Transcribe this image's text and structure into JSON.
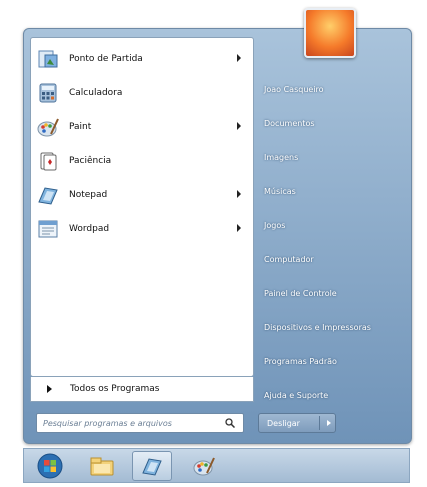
{
  "start_menu": {
    "programs": [
      {
        "label": "Ponto de Partida",
        "icon": "ponto-de-partida-icon",
        "has_submenu": true
      },
      {
        "label": "Calculadora",
        "icon": "calculator-icon",
        "has_submenu": false
      },
      {
        "label": "Paint",
        "icon": "paint-icon",
        "has_submenu": true
      },
      {
        "label": "Paciência",
        "icon": "solitaire-icon",
        "has_submenu": false
      },
      {
        "label": "Notepad",
        "icon": "notepad-icon",
        "has_submenu": true
      },
      {
        "label": "Wordpad",
        "icon": "wordpad-icon",
        "has_submenu": true
      }
    ],
    "all_programs_label": "Todos os Programas",
    "search_placeholder": "Pesquisar programas e arquivos",
    "right_items": [
      "Joao Casqueiro",
      "Documentos",
      "Imagens",
      "Músicas",
      "Jogos",
      "Computador",
      "Painel de Controle",
      "Dispositivos e Impressoras",
      "Programas Padrão",
      "Ajuda e Suporte"
    ],
    "shutdown_label": "Desligar"
  },
  "taskbar": {
    "items": [
      "start-orb-icon",
      "explorer-icon",
      "notepad-icon",
      "paint-icon"
    ]
  },
  "colors": {
    "menu_blue": "#7a9cc0",
    "text_white": "#ffffff"
  }
}
